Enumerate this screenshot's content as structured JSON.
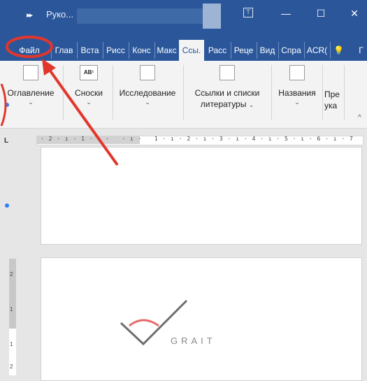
{
  "titlebar": {
    "doc_title": "Руко...",
    "quick_access_glyph": "▸▸",
    "min_glyph": "—",
    "max_glyph": "☐",
    "close_glyph": "✕",
    "ribbon_display_glyph": "⊤"
  },
  "tabs": [
    {
      "label": "Файл"
    },
    {
      "label": "Глав"
    },
    {
      "label": "Вста"
    },
    {
      "label": "Рисс"
    },
    {
      "label": "Конс"
    },
    {
      "label": "Макс"
    },
    {
      "label": "Ссы."
    },
    {
      "label": "Расс"
    },
    {
      "label": "Реце"
    },
    {
      "label": "Вид"
    },
    {
      "label": "Спра"
    },
    {
      "label": "ACR("
    },
    {
      "label": "💡"
    },
    {
      "label": "Г"
    }
  ],
  "ribbon": {
    "toc": {
      "label": "Оглавление",
      "icon": "toc-icon"
    },
    "footnotes": {
      "label": "Сноски",
      "icon": "footnote-icon",
      "icon_text": "AB¹"
    },
    "research": {
      "label": "Исследование",
      "icon": "research-icon"
    },
    "citations": {
      "label_line1": "Ссылки и списки",
      "label_line2": "литературы",
      "icon": "citation-icon"
    },
    "captions": {
      "label": "Названия",
      "icon": "caption-icon"
    },
    "index": {
      "label_line1": "Пре",
      "label_line2": "ука"
    },
    "chevron": "⌄",
    "collapse_glyph": "^"
  },
  "ruler": {
    "corner": "L",
    "ticks": "· 2 · ı · 1 · ı ·   · ı ·   1 · ı · 2 · ı · 3 · ı · 4 · ı · 5 · ı · 6 · ı · 7"
  },
  "vruler": {
    "t1": "2",
    "t2": "1",
    "t3": "1",
    "t4": "2"
  },
  "logo": {
    "text": "GRAIT"
  },
  "colors": {
    "brand": "#2b579a",
    "annotation": "#e2362b"
  }
}
